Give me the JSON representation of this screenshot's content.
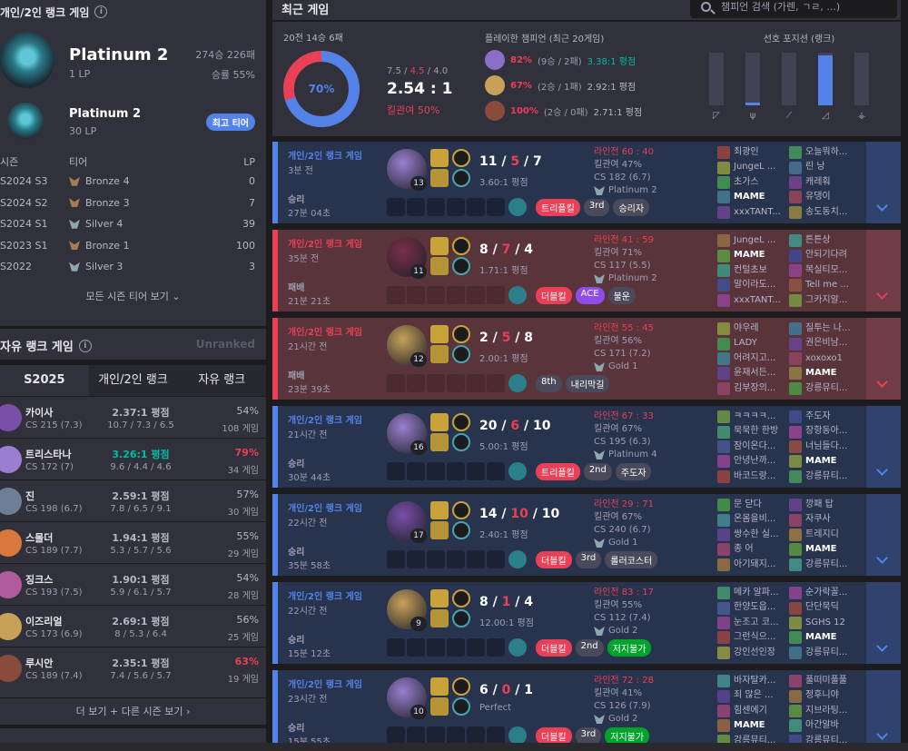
{
  "solo_rank": {
    "title": "개인/2인 랭크 게임",
    "tier": "Platinum 2",
    "lp": "1 LP",
    "wl": "274승 226패",
    "winrate": "승률 55%",
    "peak_tier": "Platinum 2",
    "peak_lp": "30 LP",
    "peak_badge": "최고 티어",
    "season_headers": [
      "시즌",
      "티어",
      "LP"
    ],
    "seasons": [
      {
        "season": "S2024 S3",
        "tier": "Bronze 4",
        "lp": "0",
        "kind": "bronze"
      },
      {
        "season": "S2024 S2",
        "tier": "Bronze 3",
        "lp": "7",
        "kind": "bronze"
      },
      {
        "season": "S2024 S1",
        "tier": "Silver 4",
        "lp": "39",
        "kind": "silver"
      },
      {
        "season": "S2023 S1",
        "tier": "Bronze 1",
        "lp": "100",
        "kind": "bronze"
      },
      {
        "season": "S2022",
        "tier": "Silver 3",
        "lp": "3",
        "kind": "silver"
      }
    ],
    "more_label": "모든 시즌 티어 보기"
  },
  "flex_rank": {
    "title": "자유 랭크 게임",
    "status": "Unranked"
  },
  "champ_stats": {
    "tabs": [
      "S2025",
      "개인/2인 랭크",
      "자유 랭크"
    ],
    "rows": [
      {
        "name": "카이사",
        "cs": "CS 215 (7.3)",
        "kda": "2.37:1 평점",
        "kda_detail": "10.7 / 7.3 / 6.5",
        "wr": "54%",
        "games": "108 게임",
        "color": "#7a4fa8",
        "good": false,
        "bad": false
      },
      {
        "name": "트리스타나",
        "cs": "CS 172 (7)",
        "kda": "3.26:1 평점",
        "kda_detail": "9.6 / 4.4 / 4.6",
        "wr": "79%",
        "games": "34 게임",
        "color": "#9a7fd0",
        "good": true,
        "bad": true
      },
      {
        "name": "진",
        "cs": "CS 198 (6.7)",
        "kda": "2.59:1 평점",
        "kda_detail": "7.8 / 6.5 / 9.1",
        "wr": "57%",
        "games": "30 게임",
        "color": "#6d7f96",
        "good": false,
        "bad": false
      },
      {
        "name": "스몰더",
        "cs": "CS 189 (7.7)",
        "kda": "1.94:1 평점",
        "kda_detail": "5.3 / 5.7 / 5.6",
        "wr": "55%",
        "games": "29 게임",
        "color": "#d8783c",
        "good": false,
        "bad": false
      },
      {
        "name": "징크스",
        "cs": "CS 193 (7.5)",
        "kda": "1.90:1 평점",
        "kda_detail": "5.9 / 6.1 / 5.7",
        "wr": "54%",
        "games": "28 게임",
        "color": "#b05b9e",
        "good": false,
        "bad": false
      },
      {
        "name": "이즈리얼",
        "cs": "CS 173 (6.9)",
        "kda": "2.69:1 평점",
        "kda_detail": "8 / 5.3 / 6.4",
        "wr": "56%",
        "games": "25 게임",
        "color": "#c7a15a",
        "good": false,
        "bad": false
      },
      {
        "name": "루시안",
        "cs": "CS 189 (7.4)",
        "kda": "2.35:1 평점",
        "kda_detail": "7.4 / 5.6 / 5.7",
        "wr": "63%",
        "games": "19 게임",
        "color": "#8a4a3c",
        "good": false,
        "bad": true
      }
    ],
    "more_label": "더 보기 + 다른 시즌 보기"
  },
  "recent": {
    "title": "최근 게임",
    "search_placeholder": "챔피언 검색 (가렌, ㄱㄹ, ...)",
    "record": "20전 14승 6패",
    "winrate_label": "70%",
    "winrate": 0.7,
    "kda_k": "7.5",
    "kda_d": "4.5",
    "kda_a": "4.0",
    "kda_ratio": "2.54 : 1",
    "kill_part": "킬관여 50%",
    "played_title": "플레이한 챔피언 (최근 20게임)",
    "played": [
      {
        "wr": "82%",
        "rec": "(9승 / 2패)",
        "kda": "3.38:1 평점",
        "good": true,
        "color": "#8a6fc6"
      },
      {
        "wr": "67%",
        "rec": "(2승 / 1패)",
        "kda": "2.92:1 평점",
        "good": false,
        "color": "#c7a15a"
      },
      {
        "wr": "100%",
        "rec": "(2승 / 0패)",
        "kda": "2.71:1 평점",
        "good": false,
        "color": "#8a4a3c"
      }
    ],
    "pos_title": "선호 포지션 (랭크)",
    "positions": [
      {
        "icon": "top-lane-icon",
        "glyph": "◸",
        "value": 0.0
      },
      {
        "icon": "jungle-icon",
        "glyph": "ψ",
        "value": 0.05
      },
      {
        "icon": "mid-lane-icon",
        "glyph": "⟋",
        "value": 0.0
      },
      {
        "icon": "bot-lane-icon",
        "glyph": "◿",
        "value": 0.95
      },
      {
        "icon": "support-icon",
        "glyph": "⚶",
        "value": 0.0
      }
    ]
  },
  "matches": [
    {
      "queue": "개인/2인 랭크 게임",
      "time": "3분 전",
      "result": "승리",
      "duration": "27분 04초",
      "win": true,
      "level": "13",
      "k": "11",
      "d": "5",
      "a": "7",
      "ratio": "3.60:1 평점",
      "lane": "라인전 60 : 40",
      "kp": "킬관여 47%",
      "cs": "CS 182 (6.7)",
      "avg": "Platinum 2",
      "badges": [
        {
          "t": "트리플킬",
          "c": "red"
        },
        {
          "t": "3rd",
          "c": ""
        },
        {
          "t": "승리자",
          "c": ""
        }
      ],
      "team1": [
        "최광인",
        "JungeL ...",
        "초가스",
        "MAME",
        "xxxTANT..."
      ],
      "team2": [
        "오늘뭐하...",
        "린 낭",
        "캐레훠",
        "유댕이",
        "송도동치..."
      ],
      "champ": "#9a7fd0"
    },
    {
      "queue": "개인/2인 랭크 게임",
      "time": "35분 전",
      "result": "패배",
      "duration": "21분 21초",
      "win": false,
      "level": "11",
      "k": "8",
      "d": "7",
      "a": "4",
      "ratio": "1.71:1 평점",
      "lane": "라인전 41 : 59",
      "kp": "킬관여 71%",
      "cs": "CS 117 (5.5)",
      "avg": "Platinum 2",
      "badges": [
        {
          "t": "더블킬",
          "c": "red"
        },
        {
          "t": "ACE",
          "c": "purple"
        },
        {
          "t": "불운",
          "c": ""
        }
      ],
      "team1": [
        "JungeL ...",
        "MAME",
        "컨털초보",
        "말이라도...",
        "xxxTANT..."
      ],
      "team2": [
        "튼튼상",
        "안되기다려",
        "복실티모...",
        "Tell me ...",
        "그카지알..."
      ],
      "champ": "#7a2f4a"
    },
    {
      "queue": "개인/2인 랭크 게임",
      "time": "21시간 전",
      "result": "패배",
      "duration": "23분 39초",
      "win": false,
      "level": "12",
      "k": "2",
      "d": "5",
      "a": "8",
      "ratio": "2.00:1 평점",
      "lane": "라인전 55 : 45",
      "kp": "킬관여 56%",
      "cs": "CS 171 (7.2)",
      "avg": "Gold 1",
      "badges": [
        {
          "t": "8th",
          "c": ""
        },
        {
          "t": "내리막길",
          "c": ""
        }
      ],
      "team1": [
        "야우레",
        "LADY",
        "어려지고...",
        "윤재서든...",
        "김부장의..."
      ],
      "team2": [
        "질투는 나...",
        "권은비남...",
        "xoxoxo1",
        "MAME",
        "강릉뮤티..."
      ],
      "champ": "#c7a15a"
    },
    {
      "queue": "개인/2인 랭크 게임",
      "time": "21시간 전",
      "result": "승리",
      "duration": "30분 44초",
      "win": true,
      "level": "16",
      "k": "20",
      "d": "6",
      "a": "10",
      "ratio": "5.00:1 평점",
      "lane": "라인전 67 : 33",
      "kp": "킬관여 67%",
      "cs": "CS 195 (6.3)",
      "avg": "Platinum 4",
      "badges": [
        {
          "t": "트리플킬",
          "c": "red"
        },
        {
          "t": "2nd",
          "c": ""
        },
        {
          "t": "주도자",
          "c": ""
        }
      ],
      "team1": [
        "ㅋㅋㅋㅋ...",
        "묵묵한 한방",
        "잠이온다...",
        "안녕난까...",
        "바코드랑..."
      ],
      "team2": [
        "주도자",
        "장항동아...",
        "너님들다...",
        "MAME",
        "강릉뮤티..."
      ],
      "champ": "#9a7fd0"
    },
    {
      "queue": "개인/2인 랭크 게임",
      "time": "22시간 전",
      "result": "승리",
      "duration": "35분 58초",
      "win": true,
      "level": "17",
      "k": "14",
      "d": "10",
      "a": "10",
      "ratio": "2.40:1 평점",
      "lane": "라인전 29 : 71",
      "kp": "킬관여 67%",
      "cs": "CS 240 (6.7)",
      "avg": "Gold 1",
      "badges": [
        {
          "t": "더블킬",
          "c": "red"
        },
        {
          "t": "3rd",
          "c": ""
        },
        {
          "t": "롤러코스터",
          "c": ""
        }
      ],
      "team1": [
        "문 닫다",
        "온몸을비...",
        "쌍수한 실...",
        "종 어",
        "아기돼지..."
      ],
      "team2": [
        "깡패 탑",
        "자쿠사",
        "트레지디",
        "MAME",
        "강릉뮤티..."
      ],
      "champ": "#7a4fa8"
    },
    {
      "queue": "개인/2인 랭크 게임",
      "time": "22시간 전",
      "result": "승리",
      "duration": "15분 12초",
      "win": true,
      "level": "9",
      "k": "8",
      "d": "1",
      "a": "4",
      "ratio": "12.00:1 평점",
      "lane": "라인전 83 : 17",
      "kp": "킬관여 55%",
      "cs": "CS 112 (7.4)",
      "avg": "Gold 2",
      "badges": [
        {
          "t": "더블킬",
          "c": "red"
        },
        {
          "t": "2nd",
          "c": ""
        },
        {
          "t": "저지불가",
          "c": "green"
        }
      ],
      "team1": [
        "메카 알파...",
        "한양도읍...",
        "눈조고 코...",
        "그런식으...",
        "강인선인장"
      ],
      "team2": [
        "순가락꼴...",
        "단단묵딕",
        "SGHS 12",
        "MAME",
        "강릉뮤티..."
      ],
      "champ": "#c7a15a"
    },
    {
      "queue": "개인/2인 랭크 게임",
      "time": "23시간 전",
      "result": "승리",
      "duration": "15분 55초",
      "win": true,
      "level": "10",
      "k": "6",
      "d": "0",
      "a": "1",
      "ratio": "Perfect",
      "lane": "라인전 72 : 28",
      "kp": "킬관여 41%",
      "cs": "CS 126 (7.9)",
      "avg": "Gold 2",
      "badges": [
        {
          "t": "더블킬",
          "c": "red"
        },
        {
          "t": "3rd",
          "c": ""
        },
        {
          "t": "저지불가",
          "c": "green"
        }
      ],
      "team1": [
        "바자탈카...",
        "죄 많은 ...",
        "힘센에기",
        "MAME",
        "강릉뮤티..."
      ],
      "team2": [
        "풀떠미풀풀",
        "정후니야",
        "지브라팅...",
        "아간알바",
        "강릉뮤티..."
      ],
      "champ": "#9a7fd0"
    }
  ]
}
